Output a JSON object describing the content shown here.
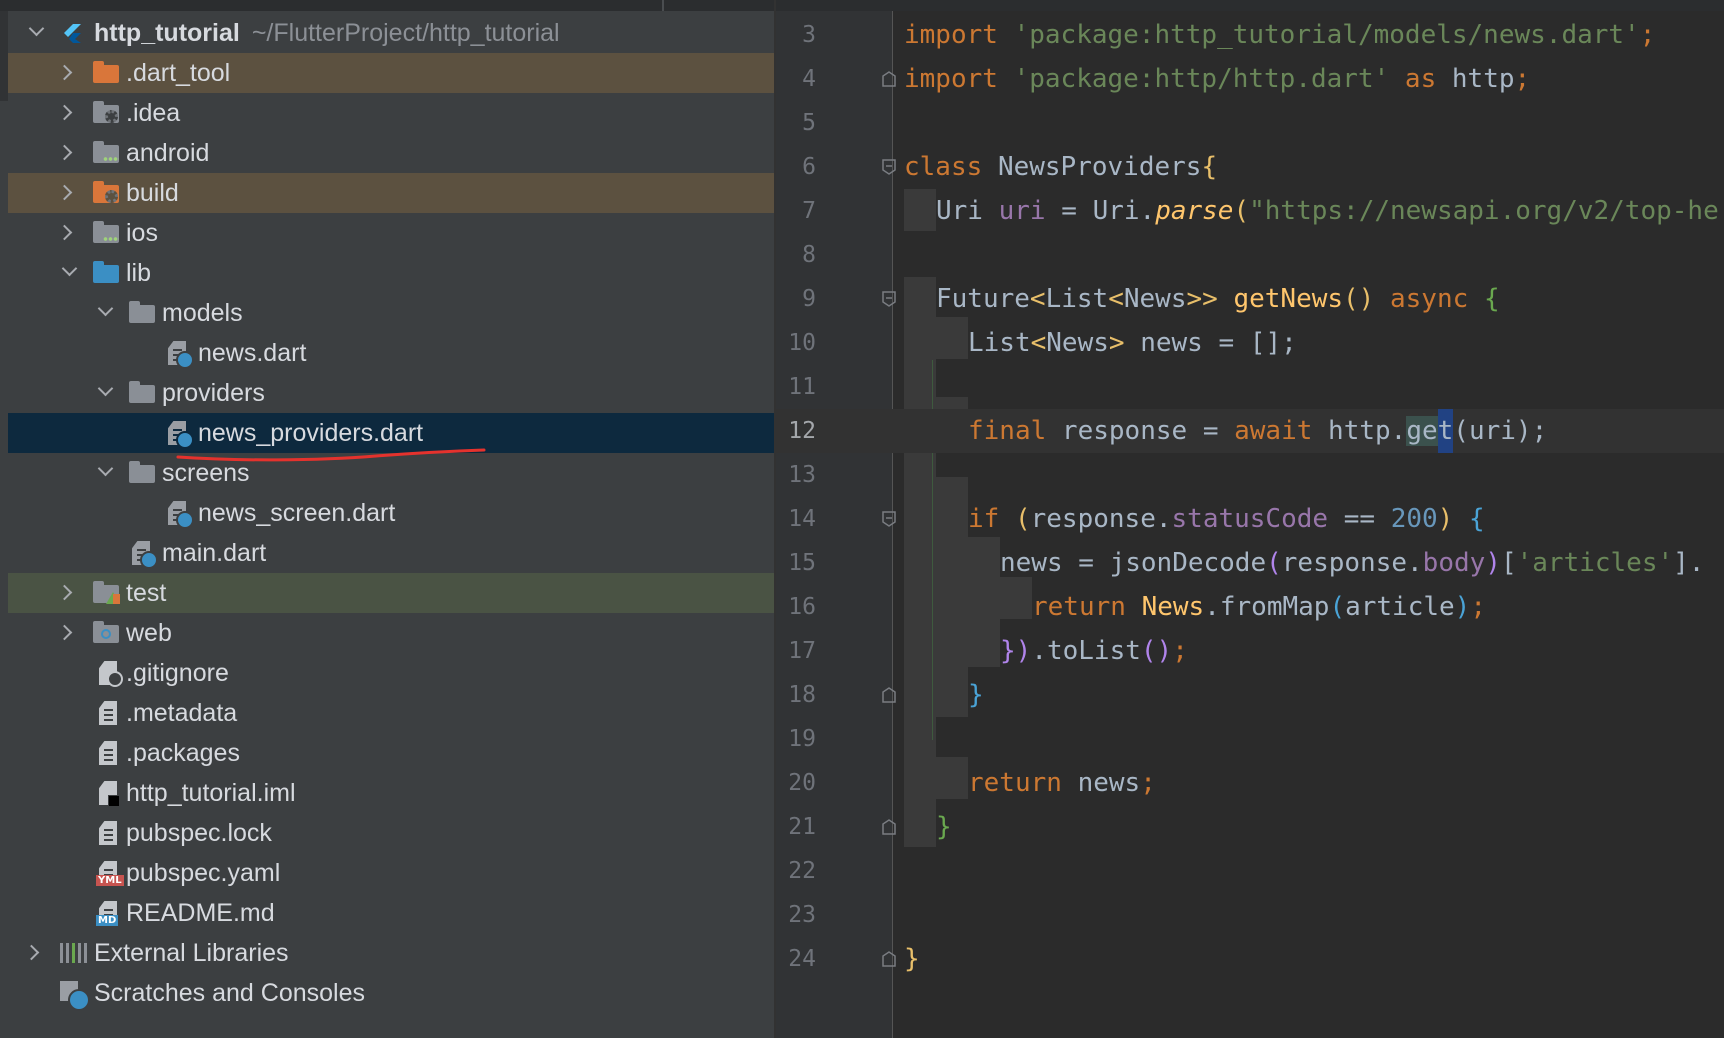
{
  "project_tree": {
    "root_name": "http_tutorial",
    "root_path": "~/FlutterProject/http_tutorial",
    "items": [
      {
        "label": ".dart_tool"
      },
      {
        "label": ".idea"
      },
      {
        "label": "android"
      },
      {
        "label": "build"
      },
      {
        "label": "ios"
      },
      {
        "label": "lib"
      },
      {
        "label": "models"
      },
      {
        "label": "news.dart"
      },
      {
        "label": "providers"
      },
      {
        "label": "news_providers.dart"
      },
      {
        "label": "screens"
      },
      {
        "label": "news_screen.dart"
      },
      {
        "label": "main.dart"
      },
      {
        "label": "test"
      },
      {
        "label": "web"
      },
      {
        "label": ".gitignore"
      },
      {
        "label": ".metadata"
      },
      {
        "label": ".packages"
      },
      {
        "label": "http_tutorial.iml"
      },
      {
        "label": "pubspec.lock"
      },
      {
        "label": "pubspec.yaml"
      },
      {
        "label": "README.md"
      }
    ],
    "external_libraries": "External Libraries",
    "scratches": "Scratches and Consoles",
    "badges": {
      "yml": "YML",
      "md": "MD"
    }
  },
  "editor": {
    "current_line": 12,
    "line_numbers": [
      "3",
      "4",
      "5",
      "6",
      "7",
      "8",
      "9",
      "10",
      "11",
      "12",
      "13",
      "14",
      "15",
      "16",
      "17",
      "18",
      "19",
      "20",
      "21",
      "22",
      "23",
      "24"
    ],
    "code": {
      "l3": {
        "kw": "import",
        "str": "'package:http_tutorial/models/news.dart'",
        "end": ";"
      },
      "l4": {
        "kw": "import",
        "str": "'package:http/http.dart'",
        "as": "as",
        "id": "http",
        "end": ";"
      },
      "l6": {
        "kw": "class",
        "name": "NewsProviders",
        "brace": "{"
      },
      "l7": {
        "type": "Uri",
        "field": "uri",
        "eq": " = ",
        "cls": "Uri",
        "fn": "parse",
        "str": "\"https://newsapi.org/v2/top-he"
      },
      "l9": {
        "t1": "Future",
        "t2": "List",
        "t3": "News",
        "fn": "getNews",
        "kw": "async",
        "brace": "{"
      },
      "l10": {
        "t1": "List",
        "t2": "News",
        "rest": " news = [];"
      },
      "l12": {
        "kw": "final",
        "mid": " response = ",
        "await": "await",
        "obj": " http.",
        "fn_a": "ge",
        "fn_b": "t",
        "call": "(uri);"
      },
      "l14": {
        "kw": "if",
        "obj": "response.",
        "prop": "statusCode",
        "op": " == ",
        "num": "200",
        "brace": "{"
      },
      "l15": {
        "pre": "news = ",
        "fn": "jsonDecode",
        "obj": "response.",
        "prop": "body",
        "str": "'articles'",
        "tail": "]."
      },
      "l16": {
        "kw": "return",
        "cls": "News",
        "fn": "fromMap",
        "arg": "article",
        "end": ";"
      },
      "l17": {
        "a": "})",
        "b": ".toList",
        "c": "();"
      },
      "l18": {
        "brace": "}"
      },
      "l20": {
        "kw": "return",
        "rest": " news",
        "end": ";"
      },
      "l21": {
        "brace": "}"
      },
      "l24": {
        "brace": "}"
      }
    }
  }
}
